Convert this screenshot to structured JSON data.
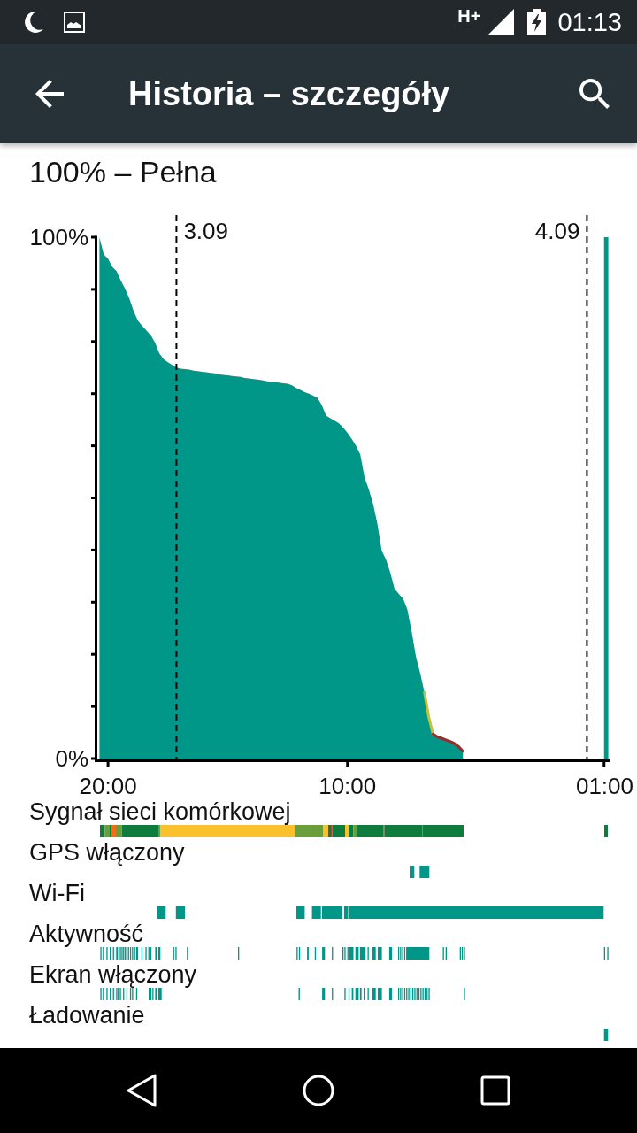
{
  "status_bar": {
    "network_type": "H+",
    "time": "01:13"
  },
  "toolbar": {
    "title": "Historia – szczegóły"
  },
  "summary": "100% – Pełna",
  "chart_data": {
    "type": "area",
    "categories": [
      null,
      null,
      "20:00",
      null,
      null,
      null,
      null,
      null,
      null,
      null,
      null,
      null,
      null,
      null,
      null,
      null,
      null,
      null,
      null,
      null,
      null,
      null,
      null,
      null,
      null,
      null,
      null,
      null,
      null,
      null,
      null,
      null,
      null,
      null,
      null,
      null,
      null,
      null,
      null,
      null,
      null,
      null,
      null,
      null,
      null,
      null,
      null,
      null,
      null,
      null,
      null,
      null,
      null,
      null,
      null,
      null,
      null,
      null,
      "10:00",
      null,
      null,
      null,
      null,
      null,
      null,
      null,
      null,
      null,
      null,
      null,
      null,
      null,
      null,
      null,
      null,
      null,
      null,
      null,
      null,
      null,
      null,
      null,
      null,
      null,
      null,
      null,
      null,
      null,
      null,
      null,
      null,
      null,
      null,
      null,
      null,
      null,
      null,
      null,
      null,
      null,
      null,
      null,
      null,
      null,
      null,
      null,
      null,
      null,
      null,
      null,
      null,
      null,
      null,
      null,
      null,
      null,
      null,
      null,
      "01:00",
      null
    ],
    "series": [
      {
        "color": "#009688",
        "values": [
          100,
          96.7,
          95.9,
          94.3,
          93.5,
          91.7,
          90.1,
          88.2,
          85.8,
          84.0,
          83.0,
          82.1,
          81.2,
          79.8,
          77.7,
          76.6,
          76.0,
          75.5,
          75.0,
          74.8,
          74.7,
          74.6,
          74.4,
          74.3,
          74.2,
          74.1,
          74.0,
          73.9,
          73.7,
          73.6,
          73.5,
          73.4,
          73.3,
          73.2,
          73.0,
          72.9,
          72.8,
          72.7,
          72.6,
          72.4,
          72.3,
          72.2,
          72.1,
          72.0,
          71.9,
          71.6,
          71.1,
          70.7,
          70.3,
          70.0,
          69.6,
          69.2,
          67.8,
          65.8,
          65.3,
          64.8,
          64.3,
          63.5,
          62.5,
          61.3,
          60.0,
          58.3,
          53.9,
          51.6,
          48.8,
          45.0,
          39.9,
          38.2,
          35.7,
          32.6,
          31.6,
          30.7,
          28.6,
          24.4,
          19.6,
          16.4,
          12.7,
          8.0,
          4.7,
          4.2,
          3.9,
          3.6,
          3.3,
          2.9,
          2.3,
          1.4,
          null,
          null,
          null,
          null,
          null,
          null,
          null,
          null,
          null,
          null,
          null,
          null,
          null,
          null,
          null,
          null,
          null,
          null,
          null,
          null,
          null,
          null,
          null,
          null,
          null,
          null,
          null,
          null,
          null,
          null,
          null,
          null,
          100,
          100
        ]
      }
    ],
    "ylim": [
      0,
      100
    ],
    "yticks": [
      {
        "value": 0,
        "label": "0%"
      },
      {
        "value": 100,
        "label": "100%"
      }
    ],
    "annotations": [
      "3.09",
      "4.09"
    ]
  },
  "tracks": [
    {
      "label": "Sygnał sieci komórkowej",
      "kind": "signal"
    },
    {
      "label": "GPS włączony",
      "kind": "on_off"
    },
    {
      "label": "Wi-Fi",
      "kind": "on_off"
    },
    {
      "label": "Aktywność",
      "kind": "on_off"
    },
    {
      "label": "Ekran włączony",
      "kind": "on_off"
    },
    {
      "label": "Ładowanie",
      "kind": "on_off"
    }
  ]
}
